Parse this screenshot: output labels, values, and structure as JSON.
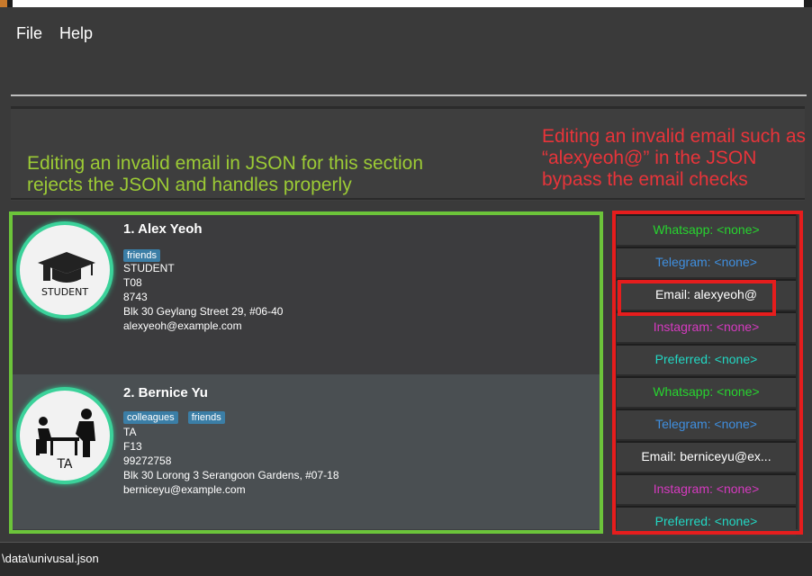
{
  "menu": {
    "file": "File",
    "help": "Help"
  },
  "notes": {
    "green": "Editing an invalid email in JSON for this section rejects the JSON and handles properly",
    "red": "Editing an invalid email such as “alexyeoh@” in the JSON bypass the email checks"
  },
  "persons": [
    {
      "index_name": "1.  Alex Yeoh",
      "tags": [
        "friends"
      ],
      "role": "STUDENT",
      "class": "T08",
      "phone": "8743",
      "address": "Blk 30 Geylang Street 29, #06-40",
      "email": "alexyeoh@example.com",
      "avatar_label": "STUDENT",
      "avatar_icon": "graduation-cap-icon"
    },
    {
      "index_name": "2.  Bernice Yu",
      "tags": [
        "colleagues",
        "friends"
      ],
      "role": "TA",
      "class": "F13",
      "phone": "99272758",
      "address": "Blk 30 Lorong 3 Serangoon Gardens, #07-18",
      "email": "berniceyu@example.com",
      "avatar_label": "TA",
      "avatar_icon": "teacher-desk-icon"
    }
  ],
  "contacts": [
    {
      "text": "Whatsapp: <none>",
      "color": "#27d42f"
    },
    {
      "text": "Telegram: <none>",
      "color": "#3f8fe0"
    },
    {
      "text": "Email: alexyeoh@",
      "color": "#ffffff"
    },
    {
      "text": "Instagram: <none>",
      "color": "#d63ac0"
    },
    {
      "text": "Preferred: <none>",
      "color": "#22d8c4"
    },
    {
      "text": "Whatsapp: <none>",
      "color": "#27d42f"
    },
    {
      "text": "Telegram: <none>",
      "color": "#3f8fe0"
    },
    {
      "text": "Email: berniceyu@ex...",
      "color": "#ffffff"
    },
    {
      "text": "Instagram: <none>",
      "color": "#d63ac0"
    },
    {
      "text": "Preferred: <none>",
      "color": "#22d8c4"
    }
  ],
  "status": {
    "path": "\\data\\univusal.json"
  },
  "colors": {
    "annotation_green": "#6cc43a",
    "annotation_red": "#e61d1d",
    "tag_bg": "#3b7ea6",
    "avatar_ring": "#3bd29a"
  }
}
